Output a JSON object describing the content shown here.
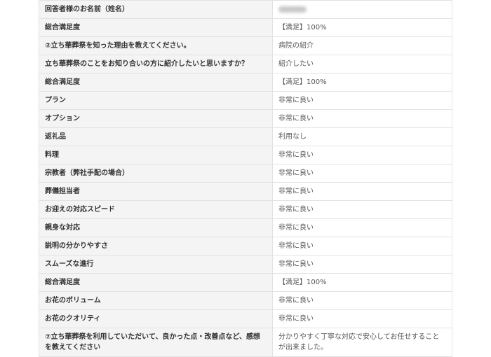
{
  "rows": [
    {
      "question": "回答者様のお名前（姓名）",
      "answer": ""
    },
    {
      "question": "総合満足度",
      "answer": "【満足】100%"
    },
    {
      "question": "②立ち華葬祭を知った理由を教えてください。",
      "answer": "病院の紹介"
    },
    {
      "question": "立ち華葬祭のことをお知り合いの方に紹介したいと思いますか？",
      "answer": "紹介したい"
    },
    {
      "question": "総合満足度",
      "answer": "【満足】100%"
    },
    {
      "question": "プラン",
      "answer": "非常に良い"
    },
    {
      "question": "オプション",
      "answer": "非常に良い"
    },
    {
      "question": "返礼品",
      "answer": "利用なし"
    },
    {
      "question": "料理",
      "answer": "非常に良い"
    },
    {
      "question": "宗教者（弊社手配の場合）",
      "answer": "非常に良い"
    },
    {
      "question": "葬儀担当者",
      "answer": "非常に良い"
    },
    {
      "question": "お迎えの対応スピード",
      "answer": "非常に良い"
    },
    {
      "question": "親身な対応",
      "answer": "非常に良い"
    },
    {
      "question": "説明の分かりやすさ",
      "answer": "非常に良い"
    },
    {
      "question": "スムーズな進行",
      "answer": "非常に良い"
    },
    {
      "question": "総合満足度",
      "answer": "【満足】100%"
    },
    {
      "question": "お花のボリューム",
      "answer": "非常に良い"
    },
    {
      "question": "お花のクオリティ",
      "answer": "非常に良い"
    },
    {
      "question": "⑦立ち華葬祭を利用していただいて、良かった点・改善点など、感想を教えてください",
      "answer": "分かりやすく丁寧な対応で安心してお任せすることが出来ました。"
    }
  ]
}
